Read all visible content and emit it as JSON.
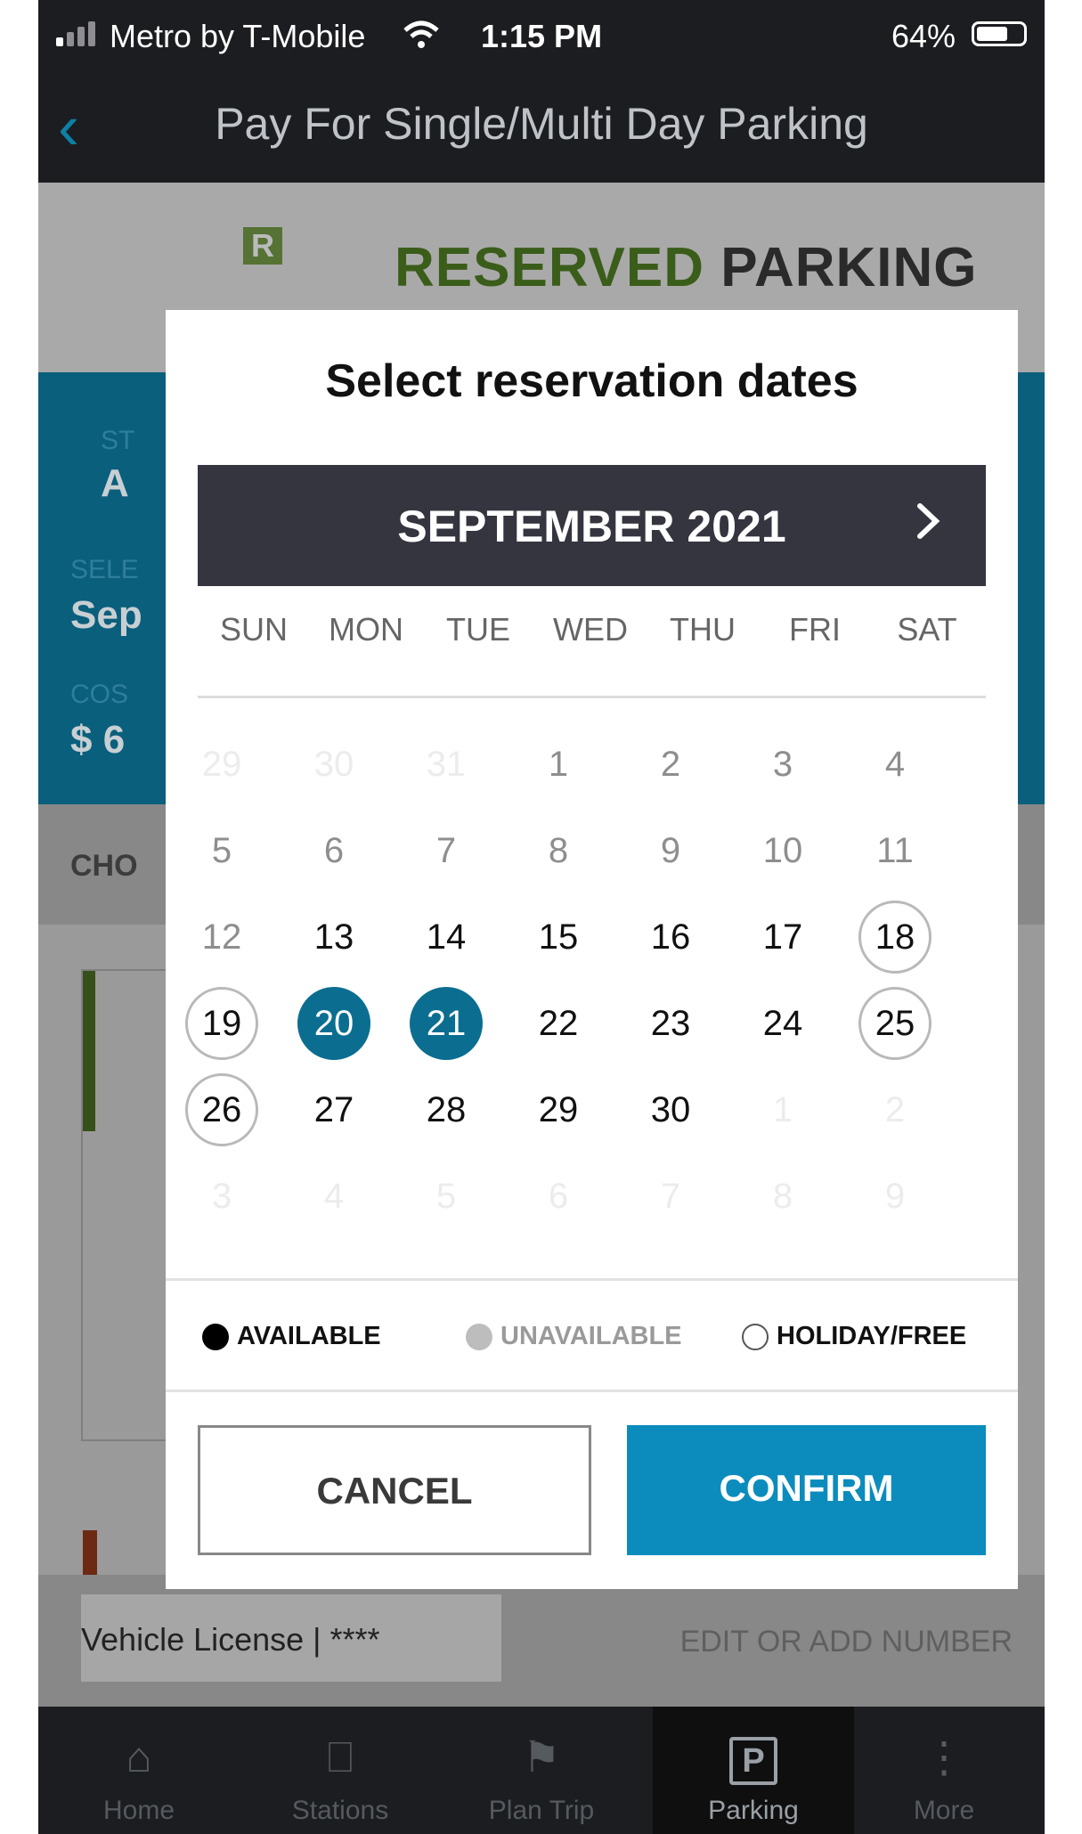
{
  "status_bar": {
    "carrier": "Metro by T-Mobile",
    "time": "1:15 PM",
    "battery": "64%"
  },
  "header": {
    "title": "Pay For Single/Multi Day Parking"
  },
  "background": {
    "logo_green": "RESERVED",
    "logo_dark": "PARKING",
    "logo_badge": "R",
    "field1_label": "ST",
    "field1_value": "A",
    "field2_label": "SELE",
    "field2_value": "Sep",
    "field3_label": "COS",
    "field3_value": "$ 6",
    "section_label": "CHO",
    "vehicle": "Vehicle License | ****",
    "edit_link": "EDIT OR ADD NUMBER"
  },
  "tabs": [
    {
      "label": "Home",
      "icon": "home-icon"
    },
    {
      "label": "Stations",
      "icon": "train-icon"
    },
    {
      "label": "Plan Trip",
      "icon": "map-pin-icon"
    },
    {
      "label": "Parking",
      "icon": "parking-icon"
    },
    {
      "label": "More",
      "icon": "more-icon"
    }
  ],
  "modal": {
    "title": "Select reservation dates",
    "month": "SEPTEMBER 2021",
    "weekdays": [
      "SUN",
      "MON",
      "TUE",
      "WED",
      "THU",
      "FRI",
      "SAT"
    ],
    "weeks": [
      [
        {
          "d": "29",
          "s": "outside"
        },
        {
          "d": "30",
          "s": "outside"
        },
        {
          "d": "31",
          "s": "outside"
        },
        {
          "d": "1",
          "s": "unavail"
        },
        {
          "d": "2",
          "s": "unavail"
        },
        {
          "d": "3",
          "s": "unavail"
        },
        {
          "d": "4",
          "s": "unavail"
        }
      ],
      [
        {
          "d": "5",
          "s": "unavail"
        },
        {
          "d": "6",
          "s": "unavail"
        },
        {
          "d": "7",
          "s": "unavail"
        },
        {
          "d": "8",
          "s": "unavail"
        },
        {
          "d": "9",
          "s": "unavail"
        },
        {
          "d": "10",
          "s": "unavail"
        },
        {
          "d": "11",
          "s": "unavail"
        }
      ],
      [
        {
          "d": "12",
          "s": "unavail"
        },
        {
          "d": "13",
          "s": "avail"
        },
        {
          "d": "14",
          "s": "avail"
        },
        {
          "d": "15",
          "s": "avail"
        },
        {
          "d": "16",
          "s": "avail"
        },
        {
          "d": "17",
          "s": "avail"
        },
        {
          "d": "18",
          "s": "holiday"
        }
      ],
      [
        {
          "d": "19",
          "s": "holiday"
        },
        {
          "d": "20",
          "s": "selected"
        },
        {
          "d": "21",
          "s": "selected"
        },
        {
          "d": "22",
          "s": "avail"
        },
        {
          "d": "23",
          "s": "avail"
        },
        {
          "d": "24",
          "s": "avail"
        },
        {
          "d": "25",
          "s": "holiday"
        }
      ],
      [
        {
          "d": "26",
          "s": "holiday"
        },
        {
          "d": "27",
          "s": "avail"
        },
        {
          "d": "28",
          "s": "avail"
        },
        {
          "d": "29",
          "s": "avail"
        },
        {
          "d": "30",
          "s": "avail"
        },
        {
          "d": "1",
          "s": "outside"
        },
        {
          "d": "2",
          "s": "outside"
        }
      ],
      [
        {
          "d": "3",
          "s": "outside"
        },
        {
          "d": "4",
          "s": "outside"
        },
        {
          "d": "5",
          "s": "outside"
        },
        {
          "d": "6",
          "s": "outside"
        },
        {
          "d": "7",
          "s": "outside"
        },
        {
          "d": "8",
          "s": "outside"
        },
        {
          "d": "9",
          "s": "outside"
        }
      ]
    ],
    "legend": {
      "available": "AVAILABLE",
      "unavailable": "UNAVAILABLE",
      "holiday": "HOLIDAY/FREE"
    },
    "cancel": "CANCEL",
    "confirm": "CONFIRM"
  },
  "colors": {
    "selected": "#0b6e90",
    "confirm": "#0b8cbd",
    "month_bar": "#34353f",
    "header": "#1c1d21"
  }
}
